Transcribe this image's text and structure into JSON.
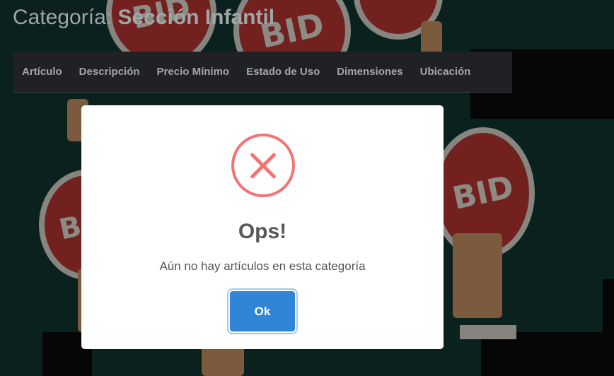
{
  "page": {
    "title_prefix": "Categoría:",
    "category_name": "Sección Infantil"
  },
  "table": {
    "columns": [
      "Artículo",
      "Descripción",
      "Precio Mínimo",
      "Estado de Uso",
      "Dimensiones",
      "Ubicación"
    ]
  },
  "background": {
    "sign_text": "BID"
  },
  "dialog": {
    "icon": "error-x-icon",
    "title": "Ops!",
    "message": "Aún no hay artículos en esta categoría",
    "confirm_label": "Ok"
  },
  "colors": {
    "error": "#f27474",
    "confirm_button": "#3085d6",
    "sign_red": "#c43a36",
    "page_background": "#133a34"
  }
}
